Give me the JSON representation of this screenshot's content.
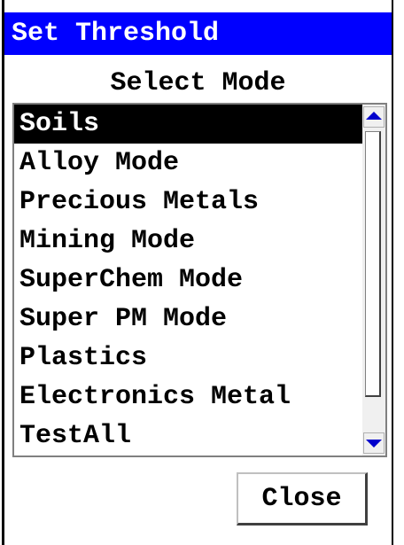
{
  "window": {
    "title": "Set Threshold"
  },
  "mode_label": "Select Mode",
  "mode_list": {
    "items": [
      "Soils",
      "Alloy Mode",
      "Precious Metals",
      "Mining Mode",
      "SuperChem Mode",
      "Super PM Mode",
      "Plastics",
      "Electronics Metal",
      "TestAll"
    ],
    "selected": "Soils"
  },
  "icons": {
    "scroll_up": "triangle-up-icon",
    "scroll_down": "triangle-down-icon"
  },
  "colors": {
    "titlebar": "#0000ff",
    "selection": "#000000",
    "arrow": "#0000cc"
  },
  "buttons": {
    "close_label": "Close"
  }
}
